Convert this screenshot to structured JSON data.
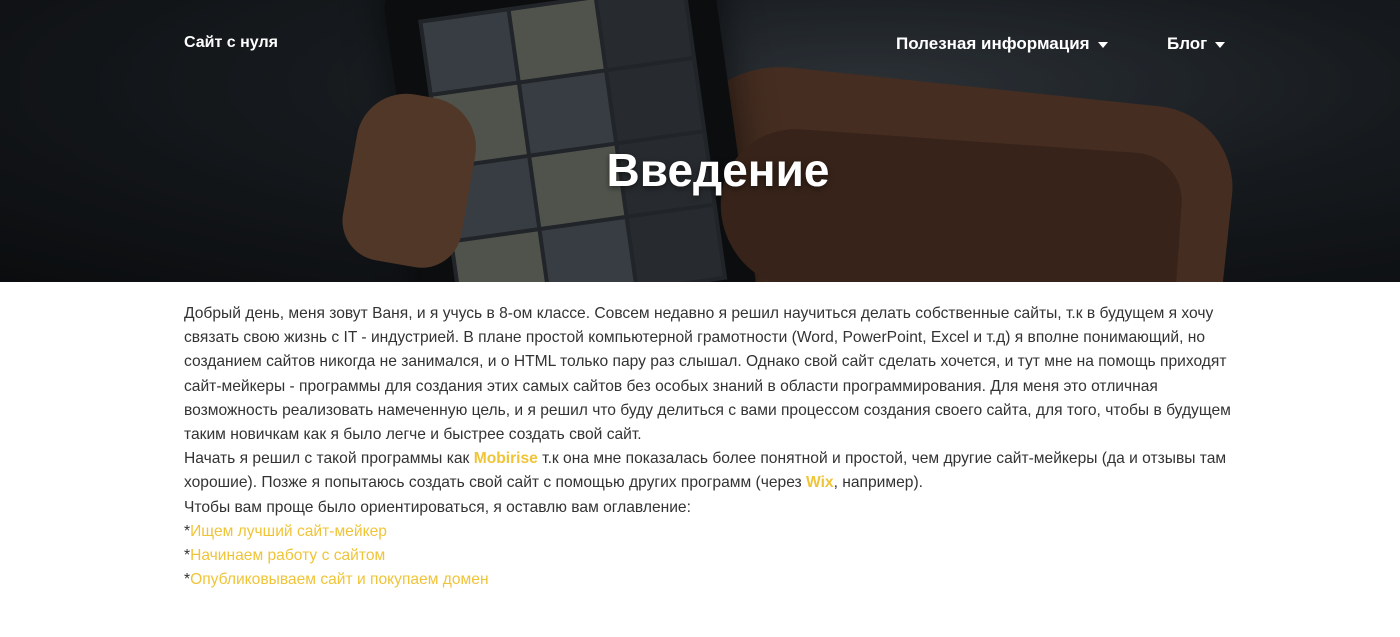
{
  "nav": {
    "brand": "Сайт с нуля",
    "menu_info": "Полезная информация",
    "menu_blog": "Блог"
  },
  "hero": {
    "title": "Введение"
  },
  "content": {
    "p1": "Добрый день, меня зовут Ваня, и я учусь в 8-ом классе. Совсем недавно я решил научиться делать собственные сайты, т.к в будущем я хочу связать свою жизнь с IT - индустрией. В плане простой компьютерной грамотности (Word, PowerPoint, Excel и т.д) я вполне понимающий, но созданием сайтов никогда не занимался, и о HTML только пару раз слышал. Однако свой сайт сделать хочется, и тут мне на помощь приходят сайт-мейкеры - программы для создания этих самых сайтов без особых знаний в области программирования. Для меня это отличная возможность реализовать намеченную цель, и я решил что буду делиться с вами процессом создания своего сайта, для того, чтобы в будущем таким новичкам как я было легче и быстрее создать свой сайт.",
    "p2_before": "Начать я решил с такой программы как ",
    "p2_mobirise": "Mobirise",
    "p2_middle": " т.к она мне показалась более понятной и простой, чем другие сайт-мейкеры (да и отзывы там хорошие). Позже я попытаюсь создать свой сайт с помощью других программ (через ",
    "p2_wix": "Wix",
    "p2_after": ", например).",
    "p3": "Чтобы вам проще было ориентироваться, я оставлю вам оглавление:",
    "toc_star": "*",
    "toc": [
      "Ищем лучший сайт-мейкер",
      "Начинаем работу с сайтом",
      "Опубликовываем сайт и покупаем домен"
    ]
  },
  "colors": {
    "accent": "#f0c437",
    "text": "#333333"
  }
}
